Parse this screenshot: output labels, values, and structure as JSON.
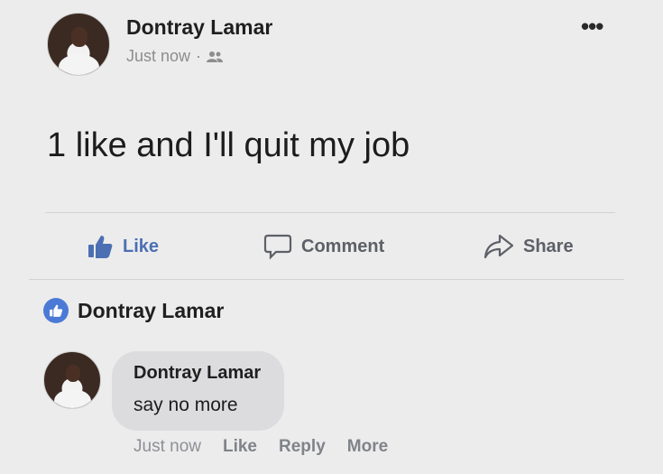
{
  "post": {
    "author": "Dontray Lamar",
    "time": "Just now",
    "separator": "·",
    "text": "1 like and I'll quit my job",
    "more": "•••"
  },
  "actions": {
    "like": "Like",
    "comment": "Comment",
    "share": "Share"
  },
  "reactions": {
    "name": "Dontray Lamar"
  },
  "comment": {
    "author": "Dontray Lamar",
    "text": "say no more",
    "time": "Just now",
    "like": "Like",
    "reply": "Reply",
    "more": "More"
  },
  "colors": {
    "background": "#ececec",
    "like_blue": "#4c6fb4",
    "bubble": "#dcdcdf"
  },
  "icons": [
    "friends-icon",
    "more-dots-icon",
    "thumbs-up-icon",
    "comment-icon",
    "share-icon",
    "like-badge-icon"
  ]
}
